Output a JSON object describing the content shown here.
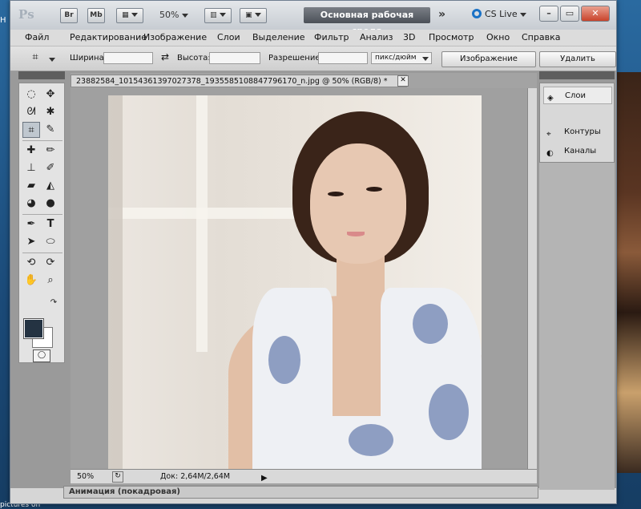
{
  "app": {
    "logo": "Ps",
    "bridge_btn": "Br",
    "minibridge_btn": "Mb",
    "zoom": "50%",
    "workspace": "Основная рабочая среда",
    "cslive": "CS Live"
  },
  "menu": [
    "Файл",
    "Редактирование",
    "Изображение",
    "Слои",
    "Выделение",
    "Фильтр",
    "Анализ",
    "3D",
    "Просмотр",
    "Окно",
    "Справка"
  ],
  "options": {
    "width_label": "Ширина:",
    "height_label": "Высота:",
    "resolution_label": "Разрешение:",
    "unit": "пикс/дюйм",
    "image_button": "Изображение",
    "delete_button": "Удалить"
  },
  "document": {
    "tab_title": "23882584_10154361397027378_1935585108847796170_n.jpg @ 50% (RGB/8) *",
    "status_zoom": "50%",
    "status_doc": "Док: 2,64M/2,64M"
  },
  "panels": {
    "layers": "Слои",
    "paths": "Контуры",
    "channels": "Каналы"
  },
  "animation": "Анимация (покадровая)",
  "desktop": {
    "bottom_text": "pictures on"
  },
  "colors": {
    "accent": "#1a72c6",
    "foreground": "#243342",
    "background": "#ffffff"
  }
}
